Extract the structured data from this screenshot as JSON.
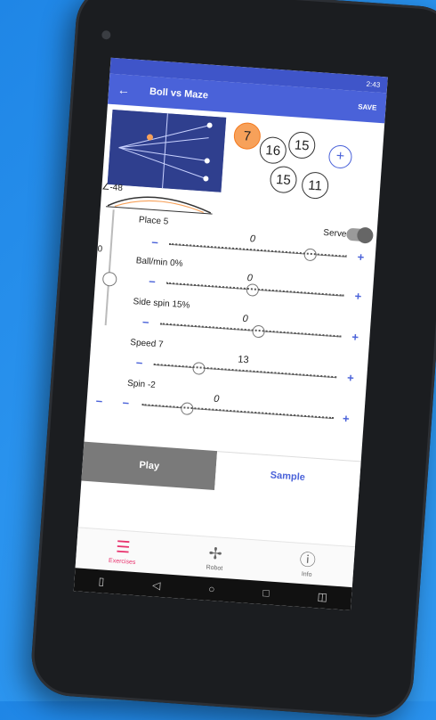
{
  "status": {
    "time": "2:43"
  },
  "appbar": {
    "title": "Boll vs Maze",
    "save_label": "SAVE"
  },
  "sequence": {
    "balls": [
      "7",
      "16",
      "15",
      "15",
      "11"
    ],
    "add_label": "+"
  },
  "controls": {
    "place": {
      "label": "Place 5",
      "zero": "0"
    },
    "serve": {
      "label": "Serve",
      "enabled": false
    },
    "angle": {
      "label": "∠-48"
    },
    "height": {
      "zero": "0"
    },
    "ball_min": {
      "label": "Ball/min 0%",
      "zero": "0"
    },
    "side_spin": {
      "label": "Side spin 15%",
      "zero": "0"
    },
    "speed": {
      "label": "Speed 7",
      "value": "13"
    },
    "spin": {
      "label": "Spin -2",
      "zero": "0"
    }
  },
  "actions": {
    "play": "Play",
    "sample": "Sample"
  },
  "nav": {
    "items": [
      {
        "label": "Exercises",
        "icon": "list-icon",
        "active": true
      },
      {
        "label": "Robot",
        "icon": "robot-icon",
        "active": false
      },
      {
        "label": "Info",
        "icon": "info-icon",
        "active": false
      }
    ]
  },
  "colors": {
    "primary": "#4a62d9",
    "accent": "#e8336e",
    "first_ball": "#f7a15a"
  }
}
